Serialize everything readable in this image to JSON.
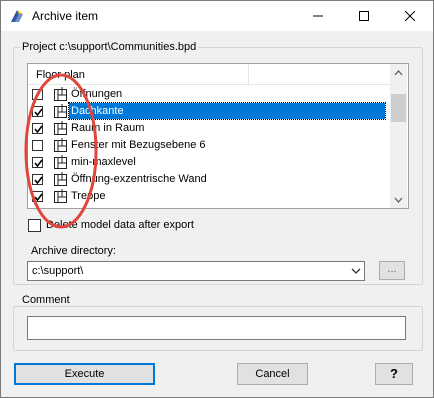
{
  "window": {
    "title": "Archive item"
  },
  "project": {
    "label": "Project c:\\support\\Communities.bpd"
  },
  "list": {
    "header": "Floor plan",
    "items": [
      {
        "label": "Öffnungen",
        "checked": false,
        "selected": false
      },
      {
        "label": "Dachkante",
        "checked": true,
        "selected": true
      },
      {
        "label": "Raum in Raum",
        "checked": true,
        "selected": false
      },
      {
        "label": "Fenster mit Bezugsebene 6",
        "checked": false,
        "selected": false
      },
      {
        "label": "min-maxlevel",
        "checked": true,
        "selected": false
      },
      {
        "label": "Öffnung-exzentrische Wand",
        "checked": true,
        "selected": false
      },
      {
        "label": "Treppe",
        "checked": true,
        "selected": false
      }
    ]
  },
  "delete_model": {
    "label": "Delete model data after export",
    "checked": false
  },
  "archive": {
    "label": "Archive directory:",
    "value": "c:\\support\\",
    "browse_label": "..."
  },
  "comment": {
    "label": "Comment",
    "value": ""
  },
  "buttons": {
    "execute": "Execute",
    "cancel": "Cancel",
    "help": "?"
  },
  "colors": {
    "selection": "#0078d7",
    "annotation": "#e0463c"
  }
}
